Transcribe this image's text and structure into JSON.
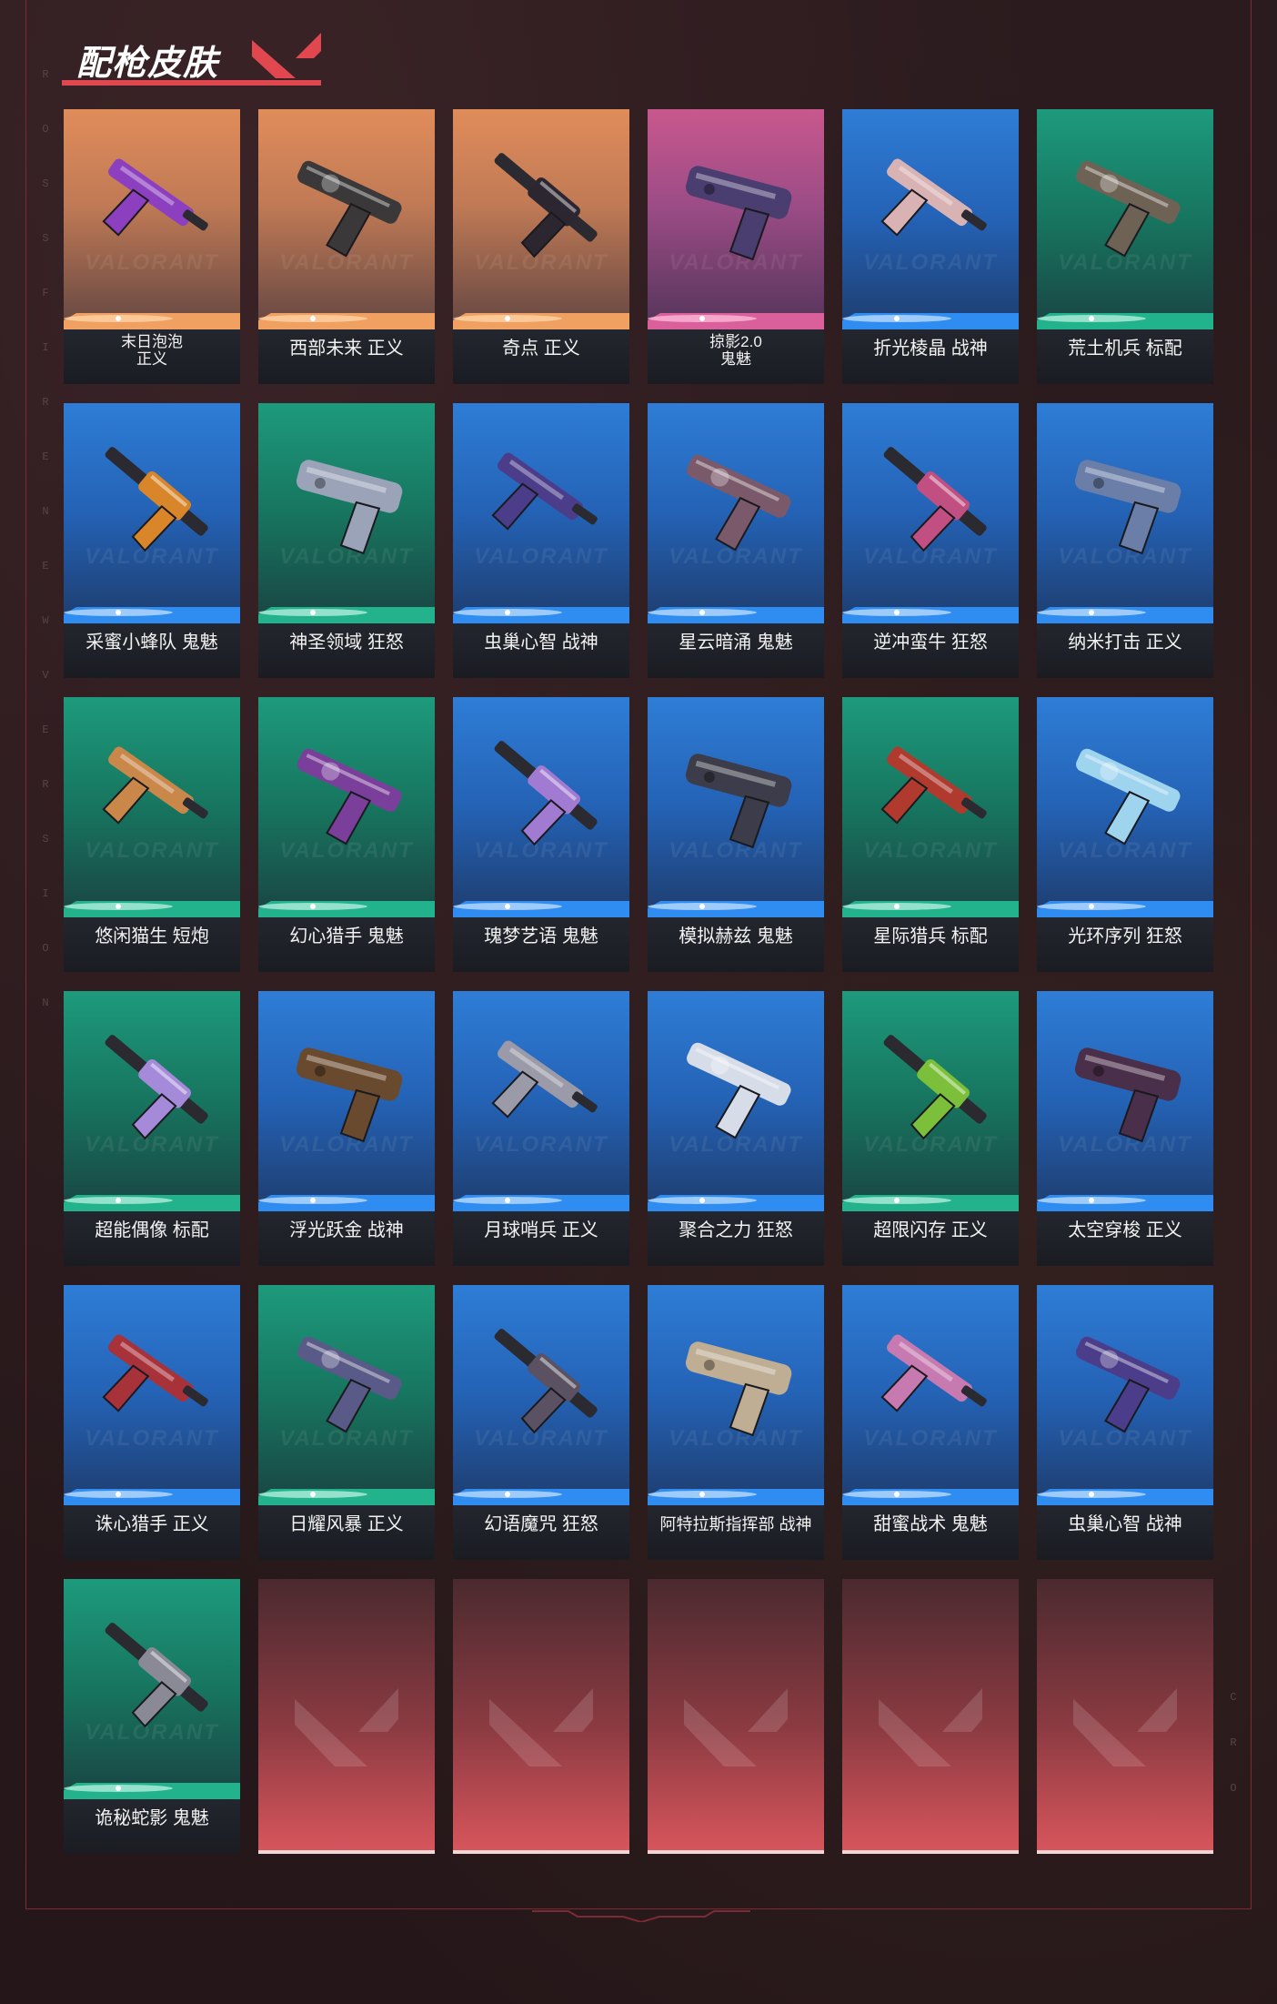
{
  "page": {
    "title": "配枪皮肤",
    "watermark": "VALORANT",
    "side_letters_left": [
      "R",
      "O",
      "S",
      "S",
      "F",
      "I",
      "R",
      "E",
      "N",
      "E",
      "W",
      "V",
      "E",
      "R",
      "S",
      "I",
      "O",
      "N"
    ],
    "side_letters_right": [
      "C",
      "R",
      "O"
    ]
  },
  "colors": {
    "accent": "#e0474f",
    "tier_orange": "#e08c5a",
    "tier_pink": "#c8588d",
    "tier_blue": "#2e7dd6",
    "tier_green": "#1d9a7c"
  },
  "skins": [
    {
      "name_line1": "末日泡泡",
      "name_line2": "正义",
      "tier": "orange",
      "weapon_color": "#8c3fbf"
    },
    {
      "name_line1": "西部未来 正义",
      "name_line2": "",
      "tier": "orange",
      "weapon_color": "#3a3838"
    },
    {
      "name_line1": "奇点 正义",
      "name_line2": "",
      "tier": "orange",
      "weapon_color": "#2c2630"
    },
    {
      "name_line1": "掠影2.0",
      "name_line2": "鬼魅",
      "tier": "pink",
      "weapon_color": "#4a3d70"
    },
    {
      "name_line1": "折光棱晶 战神",
      "name_line2": "",
      "tier": "blue",
      "weapon_color": "#d9b3b3"
    },
    {
      "name_line1": "荒土机兵 标配",
      "name_line2": "",
      "tier": "green",
      "weapon_color": "#6e6255"
    },
    {
      "name_line1": "采蜜小蜂队 鬼魅",
      "name_line2": "",
      "tier": "blue",
      "weapon_color": "#d9862a"
    },
    {
      "name_line1": "神圣领域 狂怒",
      "name_line2": "",
      "tier": "green",
      "weapon_color": "#9aa3b8"
    },
    {
      "name_line1": "虫巢心智 战神",
      "name_line2": "",
      "tier": "blue",
      "weapon_color": "#4b3d8a"
    },
    {
      "name_line1": "星云暗涌 鬼魅",
      "name_line2": "",
      "tier": "blue",
      "weapon_color": "#7a5a6a"
    },
    {
      "name_line1": "逆冲蛮牛 狂怒",
      "name_line2": "",
      "tier": "blue",
      "weapon_color": "#c24f82"
    },
    {
      "name_line1": "纳米打击 正义",
      "name_line2": "",
      "tier": "blue",
      "weapon_color": "#6a7ea8"
    },
    {
      "name_line1": "悠闲猫生 短炮",
      "name_line2": "",
      "tier": "green",
      "weapon_color": "#c9874a"
    },
    {
      "name_line1": "幻心猎手 鬼魅",
      "name_line2": "",
      "tier": "green",
      "weapon_color": "#7a3f9a"
    },
    {
      "name_line1": "瑰梦艺语 鬼魅",
      "name_line2": "",
      "tier": "blue",
      "weapon_color": "#a17ad1"
    },
    {
      "name_line1": "模拟赫兹 鬼魅",
      "name_line2": "",
      "tier": "blue",
      "weapon_color": "#3c3c4a"
    },
    {
      "name_line1": "星际猎兵 标配",
      "name_line2": "",
      "tier": "green",
      "weapon_color": "#b03a2e"
    },
    {
      "name_line1": "光环序列 狂怒",
      "name_line2": "",
      "tier": "blue",
      "weapon_color": "#9fd4ef"
    },
    {
      "name_line1": "超能偶像 标配",
      "name_line2": "",
      "tier": "green",
      "weapon_color": "#a58ad9"
    },
    {
      "name_line1": "浮光跃金 战神",
      "name_line2": "",
      "tier": "blue",
      "weapon_color": "#6a4a2e"
    },
    {
      "name_line1": "月球哨兵 正义",
      "name_line2": "",
      "tier": "blue",
      "weapon_color": "#9a9aa8"
    },
    {
      "name_line1": "聚合之力 狂怒",
      "name_line2": "",
      "tier": "blue",
      "weapon_color": "#d7dde8"
    },
    {
      "name_line1": "超限闪存 正义",
      "name_line2": "",
      "tier": "green",
      "weapon_color": "#7bbf3a"
    },
    {
      "name_line1": "太空穿梭 正义",
      "name_line2": "",
      "tier": "blue",
      "weapon_color": "#4a2f4a"
    },
    {
      "name_line1": "诛心猎手 正义",
      "name_line2": "",
      "tier": "blue",
      "weapon_color": "#a8323a"
    },
    {
      "name_line1": "日耀风暴 正义",
      "name_line2": "",
      "tier": "green",
      "weapon_color": "#5a5a88"
    },
    {
      "name_line1": "幻语魔咒 狂怒",
      "name_line2": "",
      "tier": "blue",
      "weapon_color": "#5a5262"
    },
    {
      "name_line1": "阿特拉斯指挥部 战神",
      "name_line2": "",
      "tier": "blue",
      "weapon_color": "#bfae94"
    },
    {
      "name_line1": "甜蜜战术 鬼魅",
      "name_line2": "",
      "tier": "blue",
      "weapon_color": "#c77ab0"
    },
    {
      "name_line1": "虫巢心智 战神",
      "name_line2": "",
      "tier": "blue",
      "weapon_color": "#4b3d8a"
    },
    {
      "name_line1": "诡秘蛇影 鬼魅",
      "name_line2": "",
      "tier": "green",
      "weapon_color": "#8a8a96"
    }
  ],
  "empty_slots": 5
}
